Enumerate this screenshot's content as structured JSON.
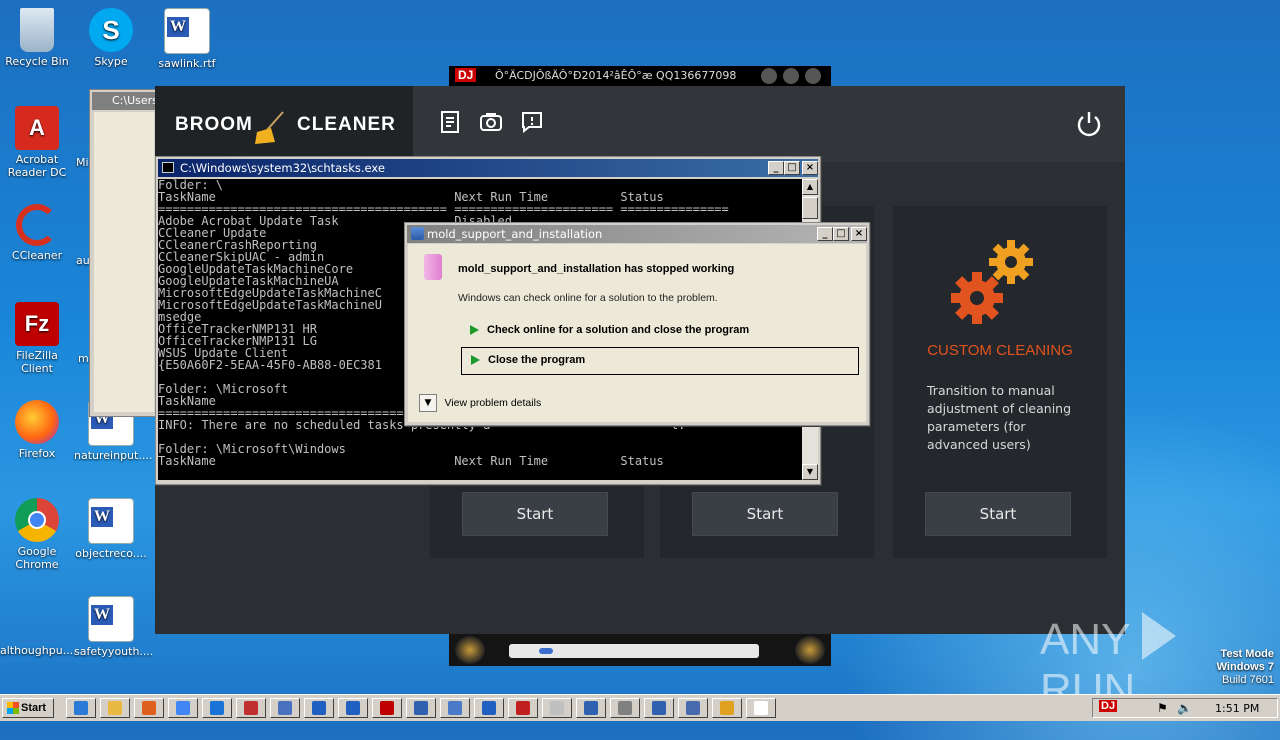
{
  "desktop": {
    "icons": [
      {
        "name": "desk-icon-recycle-bin",
        "label": "Recycle Bin"
      },
      {
        "name": "desk-icon-skype",
        "label": "Skype"
      },
      {
        "name": "desk-icon-sawlink",
        "label": "sawlink.rtf"
      },
      {
        "name": "desk-icon-acrobat",
        "label": "Acrobat Reader DC"
      },
      {
        "name": "desk-icon-ccleaner",
        "label": "CCleaner"
      },
      {
        "name": "desk-icon-filezilla",
        "label": "FileZilla Client"
      },
      {
        "name": "desk-icon-firefox",
        "label": "Firefox"
      },
      {
        "name": "desk-icon-natureinput",
        "label": "natureinput...."
      },
      {
        "name": "desk-icon-chrome",
        "label": "Google Chrome"
      },
      {
        "name": "desk-icon-objectreco",
        "label": "objectreco...."
      },
      {
        "name": "desk-icon-althoughpu",
        "label": "althoughpu...."
      },
      {
        "name": "desk-icon-safetyyouth",
        "label": "safetyyouth...."
      }
    ],
    "partial_labels": {
      "mi": "Mi",
      "au": "au",
      "m": "m"
    },
    "hidden_window_title": "C:\\Users",
    "watermark": {
      "text_left": "ANY",
      "text_right": "RUN"
    },
    "os_badge": {
      "line1": "Test Mode",
      "line2": "Windows 7",
      "line3": "Build 7601"
    }
  },
  "media_player": {
    "title": "Ô°ÄCDJÔßÄÔ°Ð2014²âÊÔ°æ QQ136677098",
    "logo": "DJ"
  },
  "broom_cleaner": {
    "logo_left": "BROOM",
    "logo_right": "CLEANER",
    "toolbar_icons": [
      "report-icon",
      "backup-icon",
      "feedback-icon"
    ],
    "power_icon": "power-icon",
    "cards": [
      {
        "start_label": "Start"
      },
      {
        "start_label": "Start"
      },
      {
        "title": "CUSTOM CLEANING",
        "description": "Transition to manual adjustment of cleaning parameters (for advanced users)",
        "start_label": "Start"
      }
    ],
    "colors": {
      "accent": "#e2541f",
      "background": "#2b2f34"
    }
  },
  "cmd_window": {
    "title": "C:\\Windows\\system32\\schtasks.exe",
    "lines": [
      "Folder: \\",
      "TaskName                                 Next Run Time          Status",
      "======================================== ====================== ===============",
      "Adobe Acrobat Update Task                Disabled",
      "CCleaner Update",
      "CCleanerCrashReporting",
      "CCleanerSkipUAC - admin",
      "GoogleUpdateTaskMachineCore",
      "GoogleUpdateTaskMachineUA",
      "MicrosoftEdgeUpdateTaskMachineC",
      "MicrosoftEdgeUpdateTaskMachineU",
      "msedge",
      "OfficeTrackerNMP131 HR",
      "OfficeTrackerNMP131 LG",
      "WSUS Update Client",
      "{E50A60F2-5EAA-45F0-AB88-0EC381",
      "",
      "Folder: \\Microsoft",
      "TaskName",
      "========================================",
      "INFO: There are no scheduled tasks presently a                         l.",
      "",
      "Folder: \\Microsoft\\Windows",
      "TaskName                                 Next Run Time          Status"
    ]
  },
  "error_dialog": {
    "title": "mold_support_and_installation",
    "heading": "mold_support_and_installation has stopped working",
    "message": "Windows can check online for a solution to the problem.",
    "option_online": "Check online for a solution and close the program",
    "option_close": "Close the program",
    "details": "View problem details"
  },
  "taskbar": {
    "start_label": "Start",
    "clock": "1:51 PM",
    "dj_label": "DJ"
  }
}
